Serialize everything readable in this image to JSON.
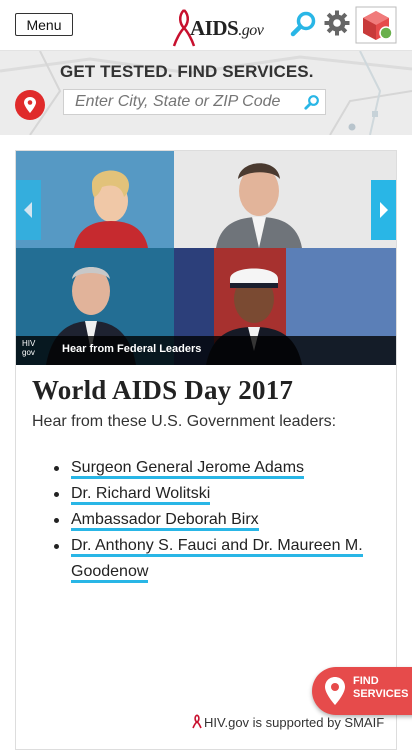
{
  "header": {
    "menu_label": "Menu",
    "logo_text": "AIDS",
    "logo_tld": ".gov",
    "icons": [
      "search-icon",
      "gear-icon",
      "app-switcher-icon"
    ]
  },
  "find_services": {
    "title": "GET TESTED. FIND SERVICES.",
    "placeholder": "Enter City, State or ZIP Code",
    "icons": [
      "location-pin-icon",
      "search-icon"
    ]
  },
  "feature": {
    "image_caption": "Hear from Federal Leaders",
    "image_logo": [
      "HIV",
      "gov"
    ],
    "title": "World AIDS Day 2017",
    "intro": "Hear from these U.S. Government leaders:",
    "leaders": [
      "Surgeon General Jerome Adams",
      "Dr. Richard Wolitski",
      "Ambassador Deborah Birx",
      "Dr. Anthony S. Fauci and Dr. Maureen M. Goodenow"
    ],
    "icons": [
      "chevron-left-icon",
      "chevron-right-icon"
    ]
  },
  "fab": {
    "line1": "FIND",
    "line2": "SERVICES"
  },
  "footer": {
    "support_text": "HIV.gov is supported by SMAIF"
  },
  "colors": {
    "accent": "#29b6e6",
    "red": "#e64b4b",
    "ribbon": "#c8102e"
  }
}
